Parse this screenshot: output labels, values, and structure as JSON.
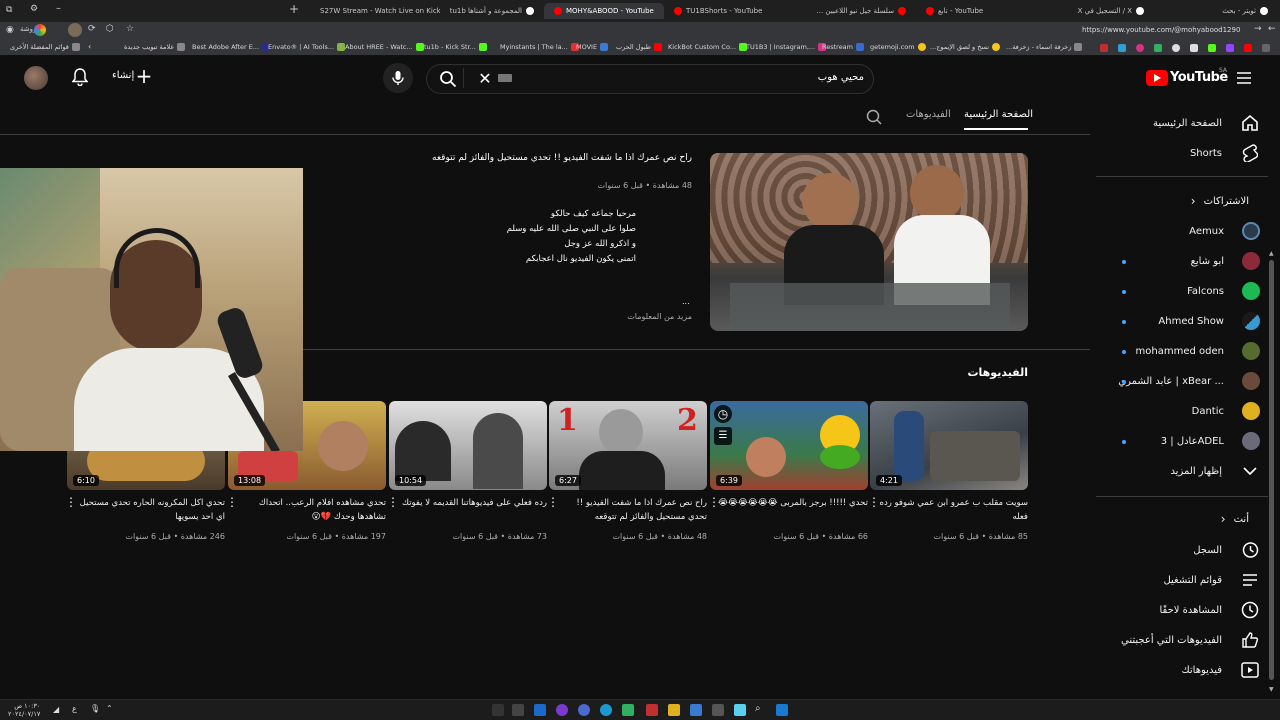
{
  "browser": {
    "tabs": [
      {
        "label": "S27W Stream - Watch Live on Kick",
        "color": "#53fc18"
      },
      {
        "label": "المجموعة و أشتاها tu1b",
        "color": "#ffffff"
      },
      {
        "label": "MOHY&ABOOD - YouTube",
        "color": "#ff0000",
        "active": true
      },
      {
        "label": "TU1BShorts - YouTube",
        "color": "#ff0000"
      },
      {
        "label": "سلسلة جيل نيو اللاعبين ...",
        "color": "#ff0000"
      },
      {
        "label": "تابع - YouTube",
        "color": "#ff0000"
      },
      {
        "label": "X / التسجيل في X",
        "color": "#ffffff"
      },
      {
        "label": "ثويتر - بحث",
        "color": "#ffffff"
      }
    ],
    "url": "https://www.youtube.com/@mohyabood1290",
    "bookmarks": [
      "الدروشة",
      "قوائم المفضلة الأخرى",
      "علامة تبويب جديدة",
      "Best Adobe After E...",
      "Envato® | AI Tools...",
      "About HREE - Watc...",
      "tu1b - Kick Str...",
      "Myinstants | The la...",
      "MOVIE",
      "طبول الحرب",
      "KickBot Custom Co...",
      "TU1B3 | Instagram,...",
      "Restream",
      "getemoji.com",
      "نسخ و لصق الإيموج...",
      "زخرفة اسماء - زخرفة..."
    ]
  },
  "header": {
    "logo_text": "YouTube",
    "region": "SA",
    "search_value": "محيي هوب",
    "create_label": "إنشاء"
  },
  "sidebar": {
    "main": [
      {
        "label": "الصفحة الرئيسية",
        "icon": "home-icon"
      },
      {
        "label": "Shorts",
        "icon": "shorts-icon"
      }
    ],
    "subs_title": "الاشتراكات",
    "subs": [
      {
        "label": "Aemux",
        "color": "#2a3a4a"
      },
      {
        "label": "ابو شايع",
        "color": "#8a2a3a"
      },
      {
        "label": "Falcons",
        "color": "#1db954"
      },
      {
        "label": "Ahmed Show",
        "color": "#1a1a1a"
      },
      {
        "label": "mohammed oden",
        "color": "#556b2f"
      },
      {
        "label": "عابد الشمري | xBear ...",
        "color": "#6a4a3a"
      },
      {
        "label": "Dantic",
        "color": "#e0b020"
      },
      {
        "label": "عادل | 3ADEL",
        "color": "#6a6a7a"
      }
    ],
    "show_more": "إظهار المزيد",
    "you_title": "أنت",
    "you": [
      {
        "label": "السجل",
        "icon": "history-icon"
      },
      {
        "label": "قوائم التشغيل",
        "icon": "playlist-icon"
      },
      {
        "label": "المشاهدة لاحقًا",
        "icon": "clock-icon"
      },
      {
        "label": "الفيديوهات التي أعجبتني",
        "icon": "like-icon"
      },
      {
        "label": "فيديوهاتك",
        "icon": "video-icon"
      }
    ]
  },
  "channel": {
    "tabs": [
      "الصفحة الرئيسية",
      "الفيديوهات"
    ],
    "featured": {
      "title": "راح نص عمرك اذا ما شفت الفيديو !! تحدي مستحيل والفائز لم تتوقعه",
      "meta": "48 مشاهدة • قبل 6 سنوات",
      "desc_lines": [
        "مرحبا جماعه كيف حالكو",
        "صلوا على النبي صلى الله عليه وسلم",
        "و اذكرو الله عز وجل",
        "اتمنى يكون الفيديو نال اعجابكم"
      ],
      "ellipsis": "...",
      "more_info": "مزيد من المعلومات"
    },
    "videos_heading": "الفيديوهات",
    "videos": [
      {
        "title": "سويت مقلب ب عمرو ابن عمي شوفو رده فعله",
        "meta": "85 مشاهدة • قبل 6 سنوات",
        "duration": "4:21",
        "thumb": "#5a6470"
      },
      {
        "title": "تحدي !!!!! برجر بالمربى 😭😭😭😭😭😭",
        "meta": "66 مشاهدة • قبل 6 سنوات",
        "duration": "6:39",
        "thumb": "#3a7a4a"
      },
      {
        "title": "راح نص عمرك اذا ما شفت الفيديو !! تحدي مستحيل والفائز لم تتوقعه",
        "meta": "48 مشاهدة • قبل 6 سنوات",
        "duration": "6:27",
        "thumb": "#8a8a8a"
      },
      {
        "title": "رده فعلي على فيديوهاتنا القديمه لا يفوتك",
        "meta": "73 مشاهدة • قبل 6 سنوات",
        "duration": "10:54",
        "thumb": "#9a9a9a"
      },
      {
        "title": "تحدي مشاهده افلام الرعب.. اتحداك تشاهدها وحدك 💔😮",
        "meta": "197 مشاهدة • قبل 6 سنوات",
        "duration": "13:08",
        "thumb": "#c0a040"
      },
      {
        "title": "تحدي اكل المكرونه الحاره تحدي مستحيل اي احد يسويها",
        "meta": "246 مشاهدة • قبل 6 سنوات",
        "duration": "6:10",
        "thumb": "#6a5a40"
      }
    ]
  },
  "taskbar": {
    "time": "١٠:٣٠ ص",
    "date": "٢٠٢٤/٠٧/١٧",
    "lang": "ع"
  }
}
